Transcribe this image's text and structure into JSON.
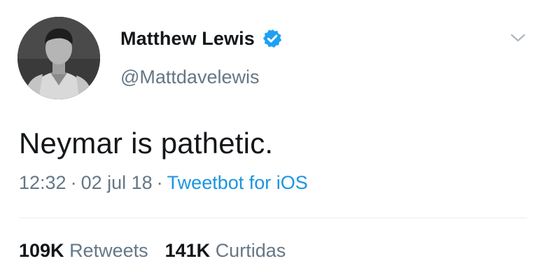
{
  "author": {
    "name": "Matthew Lewis",
    "handle": "@Mattdavelewis",
    "verified_icon": "verified-badge-icon"
  },
  "tweet": {
    "text": "Neymar is pathetic.",
    "time": "12:32",
    "date": "02 jul 18",
    "source": "Tweetbot for iOS",
    "separator": "·"
  },
  "stats": {
    "retweets_count": "109K",
    "retweets_label": "Retweets",
    "likes_count": "141K",
    "likes_label": "Curtidas"
  },
  "colors": {
    "text": "#14171a",
    "secondary": "#657786",
    "accent": "#1b95e0",
    "divider": "#e6ecf0"
  }
}
